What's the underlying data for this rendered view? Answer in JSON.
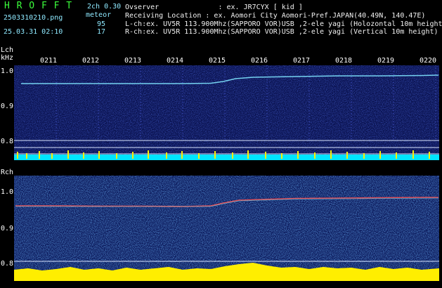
{
  "header": {
    "logo": "H R O F F T",
    "version": "2ch 0.30",
    "filename": "2503310210.png",
    "meteor_label": "meteor",
    "meteor_l": "95",
    "meteor_r": "17",
    "datetime": "25.03.31 02:10",
    "observer": "Ovserver              : ex. JR7CYX [ kid ]",
    "location": "Receiving Location : ex. Aomori City Aomori-Pref.JAPAN(40.49N, 140.47E)",
    "lch": "L-ch:ex. UV5R 113.900Mhz(SAPPORO VOR)USB ,2-ele yagi (Holozontal 10m height",
    "rch": "R-ch:ex. UV5R 113.900Mhz(SAPPORO VOR)USB ,2-ele yagi (Vertical 10m height)"
  },
  "lpanel": {
    "label_ch": "Lch",
    "label_unit": "kHz",
    "y_ticks": [
      "1.0",
      "0.9",
      "0.8"
    ],
    "x_ticks": [
      "0211",
      "0212",
      "0213",
      "0214",
      "0215",
      "0216",
      "0217",
      "0218",
      "0219",
      "0220"
    ]
  },
  "rpanel": {
    "label_ch": "Rch",
    "y_ticks": [
      "1.0",
      "0.9",
      "0.8"
    ]
  },
  "colors": {
    "background": "#000000",
    "spectrogram_bg": "#0a1250",
    "trace_l": "#7fe6ff",
    "trace_r": "#ff5050",
    "level_l": "#00e5ff",
    "level_y": "#ffee00"
  }
}
